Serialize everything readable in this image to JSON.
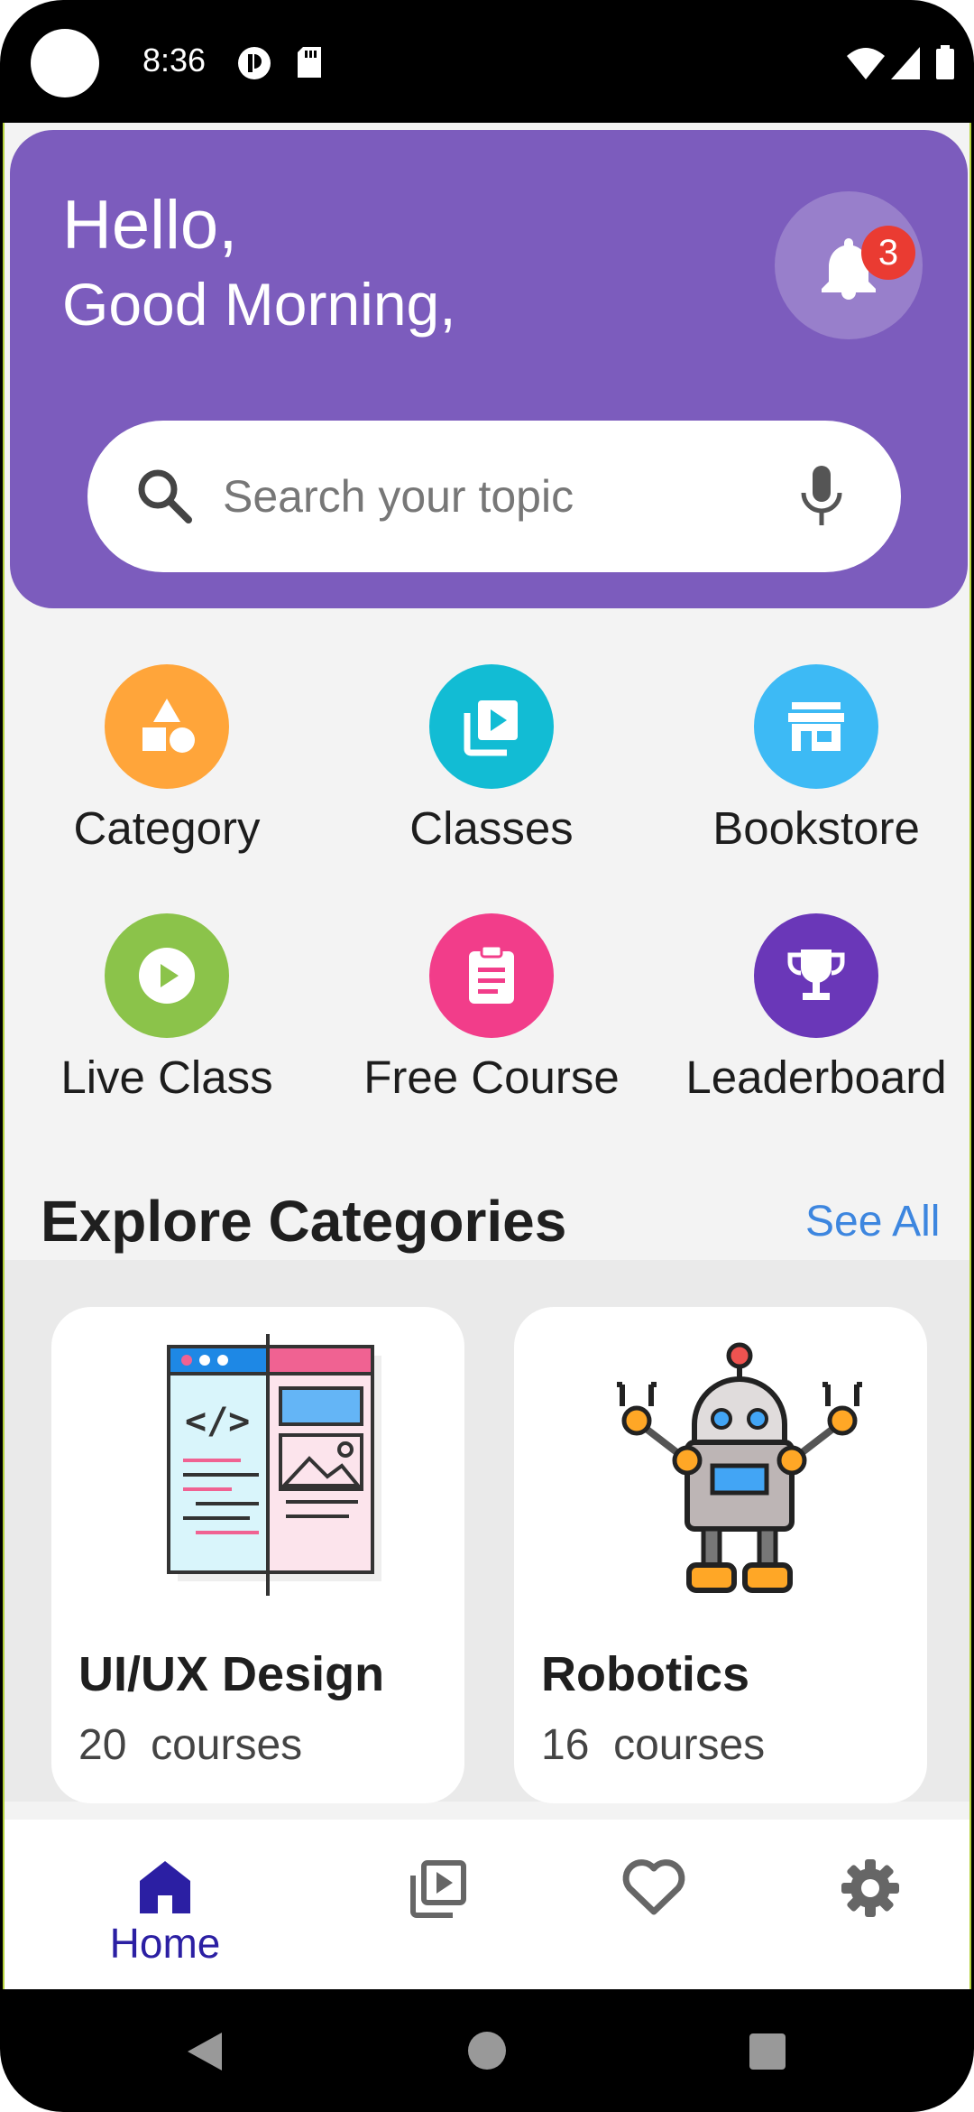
{
  "status_bar": {
    "time": "8:36"
  },
  "header": {
    "hello": "Hello,",
    "greeting": "Good Morning,",
    "notification_count": "3"
  },
  "search": {
    "placeholder": "Search your topic"
  },
  "quick_actions": [
    {
      "label": "Category",
      "icon": "shapes-icon",
      "color": "#ffa53a"
    },
    {
      "label": "Classes",
      "icon": "video-library-icon",
      "color": "#12bcd4"
    },
    {
      "label": "Bookstore",
      "icon": "store-icon",
      "color": "#3dbaf5"
    },
    {
      "label": "Live Class",
      "icon": "play-circle-icon",
      "color": "#8bc34a"
    },
    {
      "label": "Free Course",
      "icon": "clipboard-icon",
      "color": "#f23d8a"
    },
    {
      "label": "Leaderboard",
      "icon": "trophy-icon",
      "color": "#6a37b8"
    }
  ],
  "explore": {
    "title": "Explore Categories",
    "see_all": "See All",
    "cards": [
      {
        "title": "UI/UX Design",
        "count": "20",
        "unit": "courses",
        "icon": "web-design-illustration"
      },
      {
        "title": "Robotics",
        "count": "16",
        "unit": "courses",
        "icon": "robot-illustration"
      }
    ]
  },
  "bottom_nav": {
    "active": "Home",
    "items": [
      {
        "label": "Home",
        "icon": "home-icon"
      },
      {
        "label": "",
        "icon": "video-library-icon"
      },
      {
        "label": "",
        "icon": "heart-icon"
      },
      {
        "label": "",
        "icon": "settings-icon"
      }
    ]
  },
  "colors": {
    "header": "#7c5cbd",
    "accent": "#2b1fa3",
    "link": "#3d86df",
    "badge": "#ea3b32"
  }
}
